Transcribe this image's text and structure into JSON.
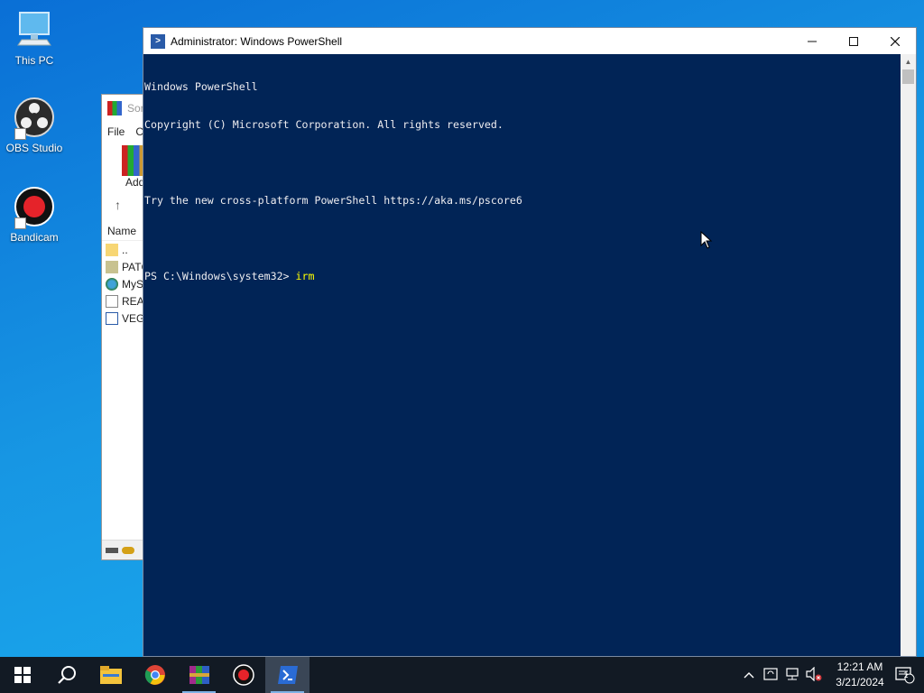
{
  "desktop": {
    "icons": [
      {
        "label": "This PC",
        "icon": "computer-icon"
      },
      {
        "label": "OBS Studio",
        "icon": "obs-icon"
      },
      {
        "label": "Bandicam",
        "icon": "bandicam-icon"
      }
    ]
  },
  "archiver": {
    "title": "Sor",
    "menu": [
      "File",
      "C"
    ],
    "toolbar_label": "Add",
    "column_name": "Name",
    "rows": [
      {
        "name": "..",
        "icon": "folder-icon"
      },
      {
        "name": "PATC",
        "icon": "archive-icon"
      },
      {
        "name": "MySc",
        "icon": "globe-icon"
      },
      {
        "name": "READ",
        "icon": "text-file-icon"
      },
      {
        "name": "VEGA",
        "icon": "app-window-icon"
      }
    ]
  },
  "powershell": {
    "title": "Administrator: Windows PowerShell",
    "lines": [
      "Windows PowerShell",
      "Copyright (C) Microsoft Corporation. All rights reserved.",
      "",
      "Try the new cross-platform PowerShell https://aka.ms/pscore6",
      ""
    ],
    "prompt": "PS C:\\Windows\\system32> ",
    "command": "irm",
    "colors": {
      "background": "#012456",
      "text": "#eeedf0",
      "command": "#ffff00"
    }
  },
  "taskbar": {
    "items": [
      "start-icon",
      "search-icon",
      "file-explorer-icon",
      "chrome-icon",
      "winrar-icon",
      "bandicam-icon",
      "powershell-icon"
    ],
    "clock_time": "12:21 AM",
    "clock_date": "3/21/2024",
    "notification_count": "1"
  }
}
